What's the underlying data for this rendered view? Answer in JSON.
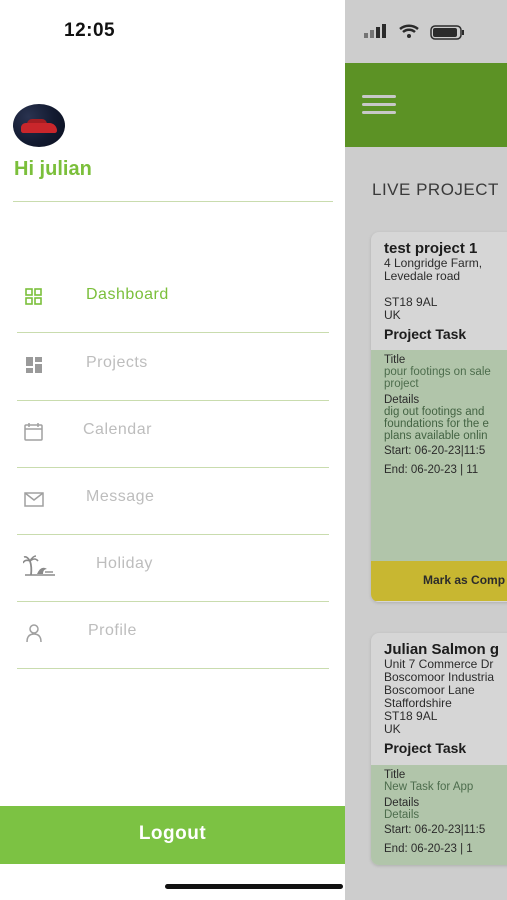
{
  "status_bar": {
    "time": "12:05"
  },
  "drawer": {
    "greeting": "Hi julian",
    "menu": [
      {
        "label": "Dashboard",
        "icon": "dashboard-grid-icon",
        "active": true
      },
      {
        "label": "Projects",
        "icon": "projects-tiles-icon",
        "active": false
      },
      {
        "label": "Calendar",
        "icon": "calendar-icon",
        "active": false
      },
      {
        "label": "Message",
        "icon": "envelope-icon",
        "active": false
      },
      {
        "label": "Holiday",
        "icon": "palm-tree-icon",
        "active": false
      },
      {
        "label": "Profile",
        "icon": "person-icon",
        "active": false
      }
    ],
    "logout_label": "Logout"
  },
  "background_screen": {
    "section_title": "LIVE PROJECT",
    "cards": [
      {
        "name": "test project 1",
        "address": "4 Longridge Farm,\nLevedale road\n\nST18 9AL\nUK",
        "task_heading": "Project Task",
        "title_label": "Title",
        "title_value": "pour footings on sale\nproject",
        "details_label": "Details",
        "details_value": "dig out footings and\nfoundations for the e\nplans available onlin",
        "start": "Start: 06-20-23|11:5",
        "end": "End: 06-20-23 | 11",
        "action_label": "Mark as Comp"
      },
      {
        "name": "Julian Salmon g",
        "address": "Unit 7 Commerce Dr\nBoscomoor Industria\nBoscomoor Lane\nStaffordshire\nST18 9AL\nUK",
        "task_heading": "Project Task",
        "title_label": "Title",
        "title_value": "New Task for App",
        "details_label": "Details",
        "details_value": "Details",
        "start": "Start: 06-20-23|11:5",
        "end": "End: 06-20-23 | 1"
      }
    ]
  },
  "colors": {
    "accent_green": "#7bbf3b",
    "header_green": "#6cab2c",
    "task_bg": "#cfe6c6",
    "action_yellow": "#e9d53a",
    "logout_bg": "#7cc243"
  }
}
